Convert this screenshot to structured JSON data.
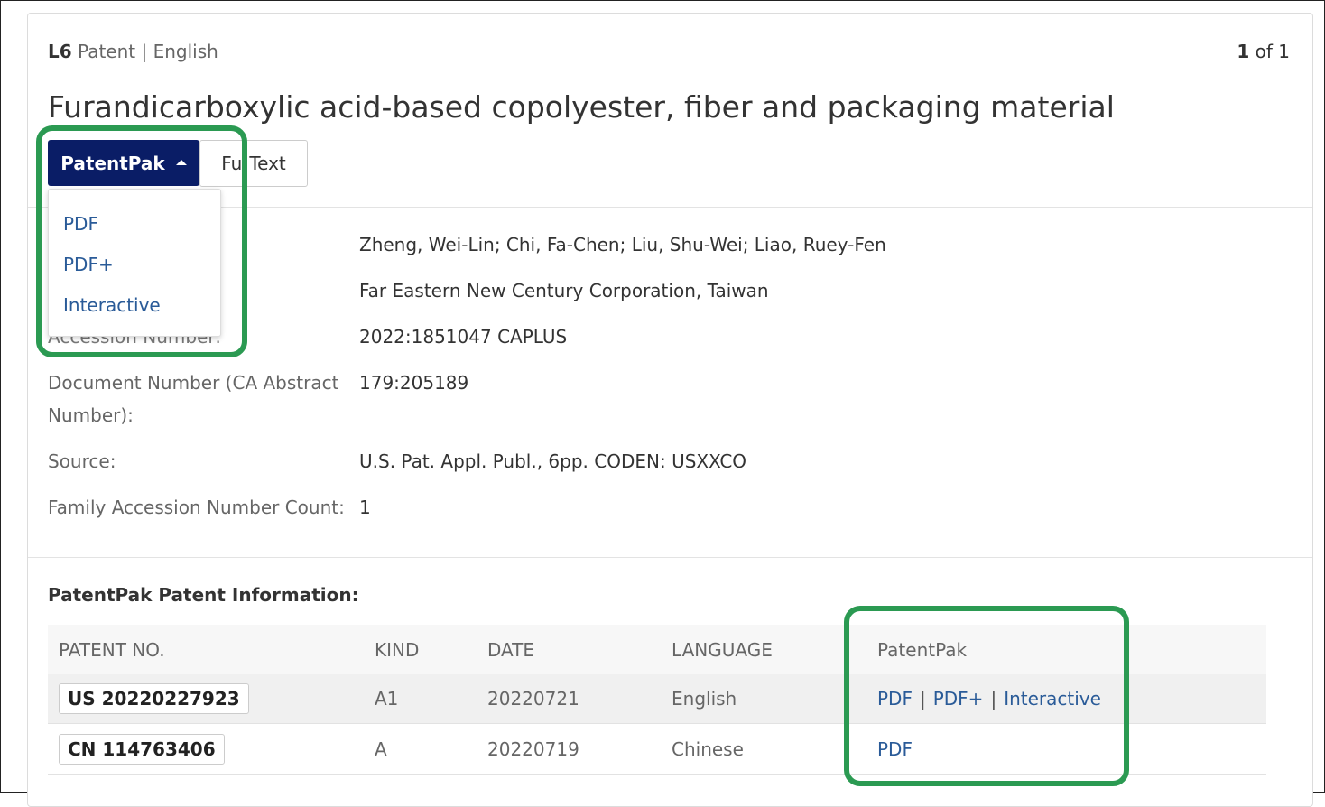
{
  "header": {
    "record_id": "L6",
    "doc_type": "Patent",
    "language": "English",
    "pager_current": "1",
    "pager_text": "of 1",
    "title": "Furandicarboxylic acid-based copolyester, fiber and packaging material"
  },
  "buttons": {
    "patentpak": "PatentPak",
    "full_text_left": "Fu",
    "full_text_right": "Text"
  },
  "dropdown": {
    "items": [
      "PDF",
      "PDF+",
      "Interactive"
    ]
  },
  "fields": {
    "hidden_label": "Accession Number:",
    "inventors": "Zheng, Wei-Lin; Chi, Fa-Chen; Liu, Shu-Wei; Liao, Ruey-Fen",
    "assignee": "Far Eastern New Century Corporation, Taiwan",
    "accession_number": "2022:1851047 CAPLUS",
    "doc_number_label_1": "Document Number (CA Abstract",
    "doc_number_label_2": "Number):",
    "doc_number": "179:205189",
    "source_label": "Source:",
    "source": "U.S. Pat. Appl. Publ., 6pp. CODEN: USXXCO",
    "family_label": "Family Accession Number Count:",
    "family_count": "1"
  },
  "patent_info": {
    "title": "PatentPak Patent Information:",
    "columns": [
      "PATENT NO.",
      "KIND",
      "DATE",
      "LANGUAGE",
      "PatentPak"
    ],
    "rows": [
      {
        "patent_no": "US 20220227923",
        "kind": "A1",
        "date": "20220721",
        "language": "English",
        "links": [
          "PDF",
          "PDF+",
          "Interactive"
        ]
      },
      {
        "patent_no": "CN 114763406",
        "kind": "A",
        "date": "20220719",
        "language": "Chinese",
        "links": [
          "PDF"
        ]
      }
    ]
  },
  "colors": {
    "primary_button": "#0a1d66",
    "link": "#2a5b98",
    "highlight": "#2b9a52"
  }
}
